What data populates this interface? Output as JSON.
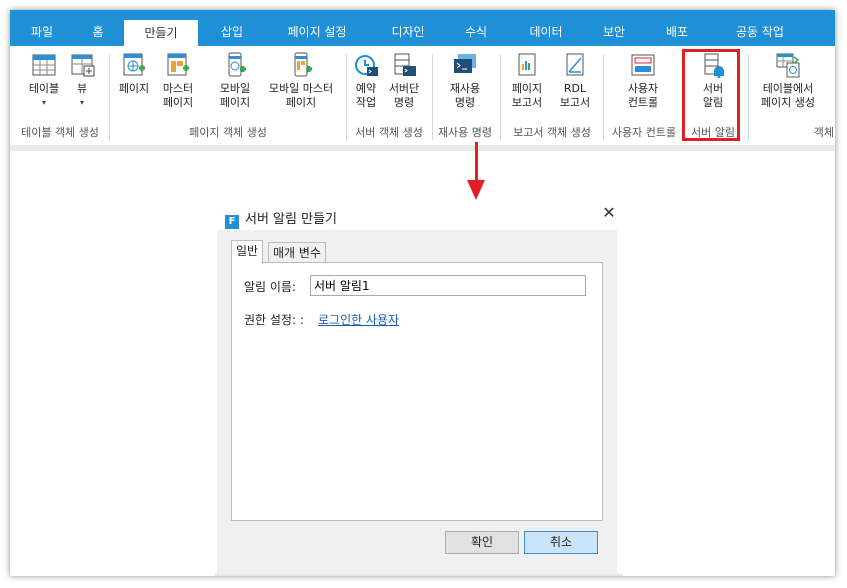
{
  "tabs": [
    "파일",
    "홈",
    "만들기",
    "삽입",
    "페이지 설정",
    "디자인",
    "수식",
    "데이터",
    "보안",
    "배포",
    "공동 작업"
  ],
  "active_tab": "만들기",
  "ribbon": {
    "buttons": {
      "table": "테이블",
      "view": "뷰",
      "page": "페이지",
      "master_page": "마스터\n페이지",
      "mobile_page": "모바일\n페이지",
      "mobile_master_page": "모바일 마스터\n페이지",
      "scheduled_job": "예약\n작업",
      "server_command": "서버단\n명령",
      "reuse_command": "재사용\n명령",
      "page_report": "페이지\n보고서",
      "rdl_report": "RDL\n보고서",
      "user_control": "사용자\n컨트롤",
      "server_alert": "서버\n알림",
      "page_from_table": "테이블에서\n페이지 생성"
    },
    "groups": {
      "table_objects": "테이블 객체 생성",
      "page_objects": "페이지 객체 생성",
      "server_objects": "서버 객체 생성",
      "reuse_command": "재사용 명령",
      "report_objects": "보고서 객체 생성",
      "user_control": "사용자 컨트롤",
      "server_alert": "서버 알림",
      "object_partial": "객체"
    }
  },
  "dialog": {
    "title": "서버 알림 만들기",
    "logo_letter": "F",
    "tabs": [
      "일반",
      "매개 변수"
    ],
    "alert_name_label": "알림 이름:",
    "alert_name_value": "서버 알림1",
    "permission_label": "권한 설정: :",
    "permission_link": "로그인한 사용자",
    "ok": "확인",
    "cancel": "취소"
  },
  "colors": {
    "accent": "#1f8fd6",
    "highlight": "#e31f26",
    "link": "#1a5fb4"
  }
}
